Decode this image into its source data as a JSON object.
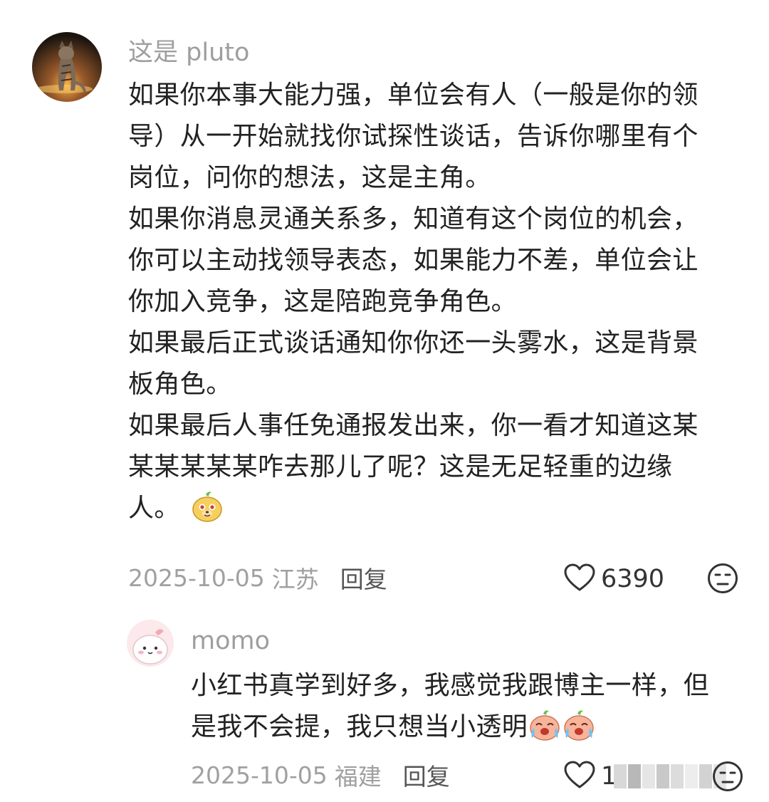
{
  "comments": [
    {
      "username": "这是 pluto",
      "lines": [
        "如果你本事大能力强，单位会有人（一般是你的领",
        "导）从一开始就找你试探性谈话，告诉你哪里有个",
        "岗位，问你的想法，这是主角。",
        "如果你消息灵通关系多，知道有这个岗位的机会，",
        "你可以主动找领导表态，如果能力不差，单位会让",
        "你加入竞争，这是陪跑竞争角色。",
        "如果最后正式谈话通知你你还一头雾水，这是背景",
        "板角色。",
        "如果最后人事任免通报发出来，你一看才知道这某",
        "某某某某某咋去那儿了呢？这是无足轻重的边缘",
        "人。"
      ],
      "emoji": "doge-emoji",
      "date": "2025-10-05",
      "location": "江苏",
      "reply_label": "回复",
      "like_count": "6390"
    }
  ],
  "replies": [
    {
      "username": "momo",
      "lines": [
        "小红书真学到好多，我感觉我跟博主一样，但",
        "是我不会提，我只想当小透明"
      ],
      "emoji": "crying-emoji",
      "date": "2025-10-05",
      "location": "福建",
      "reply_label": "回复",
      "like_count": "1"
    }
  ],
  "icons": {
    "like": "heart-outline-icon",
    "dislike": "unamused-face-icon"
  },
  "colors": {
    "text": "#222222",
    "muted": "#9e9e9e",
    "background": "#ffffff"
  }
}
